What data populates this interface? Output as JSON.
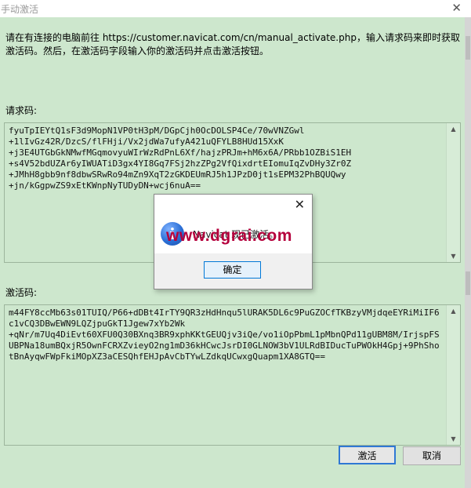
{
  "window": {
    "title": "手动激活"
  },
  "instructions": "请在有连接的电脑前往 https://customer.navicat.com/cn/manual_activate.php，输入请求码来即时获取激活码。然后，在激活码字段输入你的激活码并点击激活按钮。",
  "request_code": {
    "label": "请求码:",
    "value": "fyuTpIEYtQ1sF3d9MopN1VP0tH3pM/DGpCjh0OcDOLSP4Ce/70wVNZGwl\n+1lIvGz42R/DzcS/flFHji/Vx2jdWa7ufyA421uQFYLB8HUd15XxK\n+j3E4UTGbGkNMwfMGqmovyuWIrWzRdPnL6Xf/hajzPRJm+hM6x6A/PRbb1OZBiS1EH\n+s4V52bdUZAr6yIWUATiD3gx4YI8Gq7FSj2hzZPg2VfQixdrtEIomuIqZvDHy3Zr0Z\n+JMhH8gbb9nf8dbwSRwRo94mZn9XqT2zGKDEUmRJ5h1JPzD0jt1sEPM32PhBQUQwy\n+jn/kGgpwZS9xEtKWnpNyTUDyDN+wcj6nuA=="
  },
  "activation_code": {
    "label": "激活码:",
    "value": "m44FY8ccMb63s01TUIQ/P66+dDBt4IrTY9QR3zHdHnqu5lURAK5DL6c9PuGZOCfTKBzyVMjdqeEYRiMiIF6c1vCQ3DBwEWN9LQZjpuGkT1Jgew7xYb2Wk\n+qNr/m7Uq4DiEvt60XFU0Q30BXnq3BR9xphKKtGEUQjv3iQe/vo1iOpPbmL1pMbnQPd11gUBM8M/IrjspFSUBPNa18umBQxjR5OwnFCRXZvieyO2ng1mD36kHCwcJsrDI0GLNOW3bV1ULRdBIDucTuPWOkH4Gpj+9PhShotBnAyqwFWpFkiMOpXZ3aCESQhfEHJpAvCbTYwLZdkqUCwxgQuapm1XA8GTQ=="
  },
  "buttons": {
    "activate": "激活",
    "cancel": "取消"
  },
  "dialog": {
    "message": "Navicat 现已激活。",
    "ok": "确定",
    "icon": "info-icon"
  },
  "watermark": "www.dgrai.com"
}
